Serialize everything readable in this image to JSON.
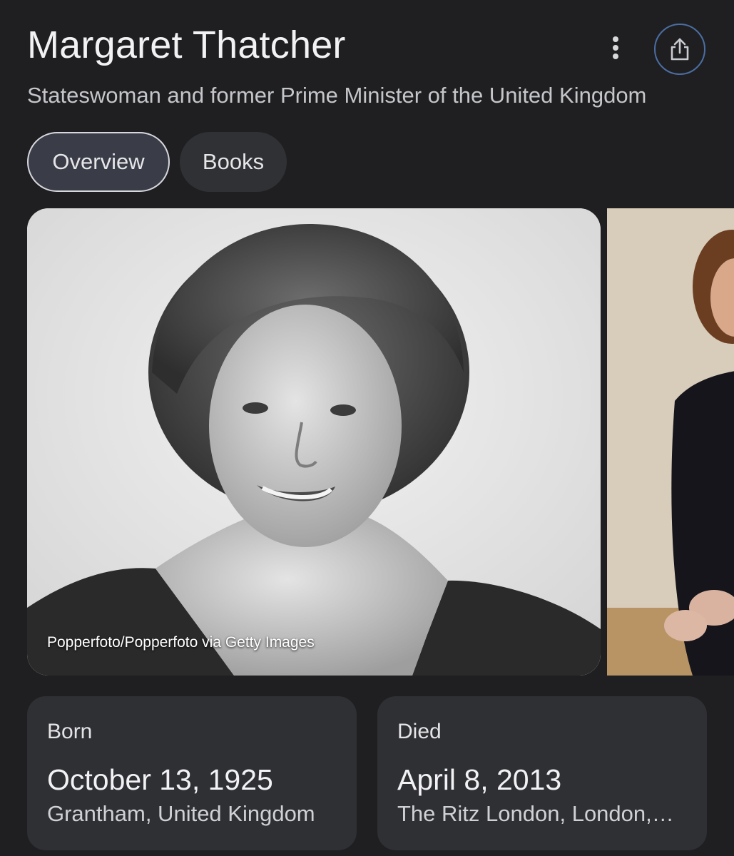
{
  "header": {
    "title": "Margaret Thatcher",
    "subtitle": "Stateswoman and former Prime Minister of the United Kingdom"
  },
  "tabs": [
    {
      "label": "Overview",
      "active": true
    },
    {
      "label": "Books",
      "active": false
    }
  ],
  "images": {
    "main_credit": "Popperfoto/Popperfoto via Getty Images"
  },
  "facts": {
    "born": {
      "label": "Born",
      "date": "October 13, 1925",
      "place": "Grantham, United Kingdom"
    },
    "died": {
      "label": "Died",
      "date": "April 8, 2013",
      "place": "The Ritz London, London,…"
    }
  },
  "icons": {
    "more": "more-vert-icon",
    "share": "share-icon"
  },
  "colors": {
    "background": "#1f1f21",
    "card": "#2f3034",
    "active_tab_fill": "#3a3c48",
    "share_ring": "#4b6ea3"
  }
}
